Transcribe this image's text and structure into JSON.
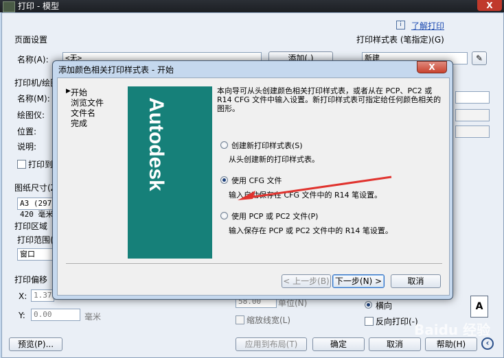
{
  "parent_window": {
    "title": "打印 - 模型",
    "close": "X",
    "learn_print": "了解打印",
    "page_setup": {
      "title": "页面设置",
      "name_label": "名称(A):",
      "name_value": "<无>",
      "add_button": "添加(.)"
    },
    "printer": {
      "title": "打印机/绘图仪",
      "name_label": "名称(M):",
      "plotter_label": "绘图仪:",
      "location_label": "位置:",
      "description_label": "说明:",
      "print_to_file": "打印到文件(F)"
    },
    "paper_size": {
      "title": "图纸尺寸(Z)",
      "value": "A3 (297 x 420 毫米)"
    },
    "print_area": {
      "title": "打印区域",
      "range_label": "打印范围(W):",
      "range_value": "窗口"
    },
    "print_offset": {
      "title": "打印偏移",
      "x_label": "X:",
      "x_value": "1.37",
      "y_label": "Y:",
      "y_value": "0.00",
      "unit": "毫米"
    },
    "print_style_table": {
      "title": "打印样式表 (笔指定)(G)",
      "value": "新建"
    },
    "scale": {
      "value": "58.00",
      "unit_label": "单位(N)",
      "scale_lineweights": "缩放线宽(L)"
    },
    "orientation": {
      "landscape": "横向",
      "upside_down": "反向打印(-)",
      "paper_icon": "A"
    },
    "bottom_buttons": {
      "preview": "预览(P)...",
      "apply_to_layout": "应用到布局(T)",
      "ok": "确定",
      "cancel": "取消",
      "help": "帮助(H)"
    }
  },
  "dialog": {
    "title": "添加颜色相关打印样式表 - 开始",
    "close": "X",
    "steps": [
      "开始",
      "浏览文件",
      "文件名",
      "完成"
    ],
    "current_step": 0,
    "logo": "Autodesk",
    "logo_color": "#168079",
    "intro": "本向导可从头创建颜色相关打印样式表，或者从在 PCP、PC2 或 R14 CFG 文件中输入设置。新打印样式表可指定给任何颜色相关的图形。",
    "options": [
      {
        "label": "创建新打印样式表(S)",
        "description": "从头创建新的打印样式表。",
        "checked": false
      },
      {
        "label": "使用 CFG 文件",
        "description": "输入自动保存在 CFG 文件中的 R14 笔设置。",
        "checked": true
      },
      {
        "label": "使用 PCP 或 PC2 文件(P)",
        "description": "输入保存在 PCP 或 PC2 文件中的 R14 笔设置。",
        "checked": false
      }
    ],
    "buttons": {
      "back": "< 上一步(B)",
      "next": "下一步(N) >",
      "cancel": "取消"
    },
    "annotation_arrow_color": "#e0332e"
  },
  "watermark": "Baidu 经验"
}
